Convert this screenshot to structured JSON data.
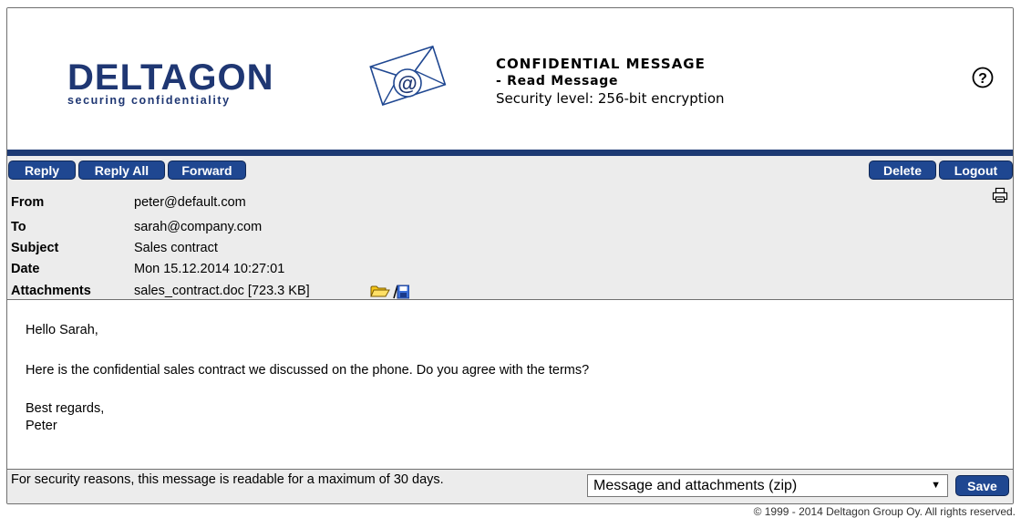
{
  "brand": {
    "name": "DELTAGON",
    "tagline": "securing confidentiality"
  },
  "header": {
    "title": "CONFIDENTIAL MESSAGE",
    "subtitle": "- Read Message",
    "security": "Security level: 256-bit encryption"
  },
  "toolbar": {
    "reply": "Reply",
    "reply_all": "Reply All",
    "forward": "Forward",
    "delete": "Delete",
    "logout": "Logout"
  },
  "message": {
    "from_label": "From",
    "from": "peter@default.com",
    "to_label": "To",
    "to": "sarah@company.com",
    "subject_label": "Subject",
    "subject": "Sales contract",
    "date_label": "Date",
    "date": "Mon 15.12.2014 10:27:01",
    "attachments_label": "Attachments",
    "attachment": "sales_contract.doc [723.3 KB]"
  },
  "body": {
    "greeting": "Hello Sarah,",
    "text": "Here is the confidential sales contract we discussed on the phone. Do you agree with the terms?",
    "closing": "Best regards,",
    "signature": "Peter"
  },
  "footer": {
    "notice": "For security reasons, this message is readable for a maximum of 30 days.",
    "download_option": "Message and attachments (zip)",
    "save": "Save",
    "copyright": "© 1999 - 2014 Deltagon Group Oy. All rights reserved."
  },
  "colors": {
    "brand_blue": "#1f3773",
    "button_blue": "#1f4791",
    "panel_gray": "#ececec"
  },
  "icons": [
    "envelope-at-icon",
    "help-icon",
    "printer-icon",
    "open-folder-icon",
    "save-disk-icon"
  ]
}
